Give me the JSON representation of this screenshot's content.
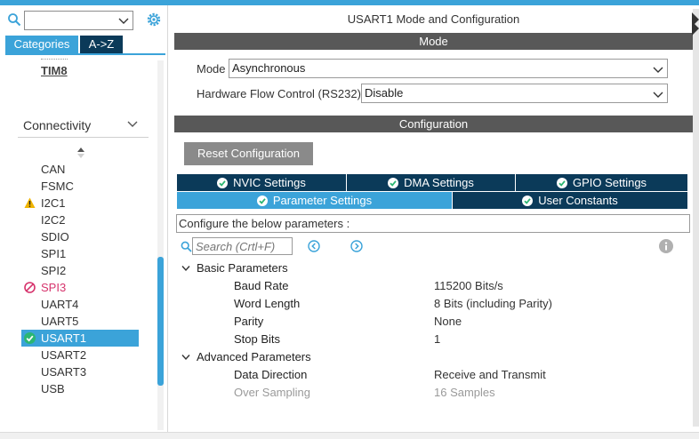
{
  "colors": {
    "accent": "#3ba3d9",
    "dark_tab": "#0b3a59",
    "bar": "#585858",
    "ok": "#2bb673",
    "warn": "#f0b400",
    "error": "#d6336c"
  },
  "left": {
    "search_value": "",
    "tabs": [
      {
        "label": "Categories",
        "active": true
      },
      {
        "label": "A->Z",
        "active": false
      }
    ],
    "timer_item": "TIM8",
    "category": "Connectivity",
    "peripherals": [
      {
        "label": "CAN",
        "status": "none"
      },
      {
        "label": "FSMC",
        "status": "none"
      },
      {
        "label": "I2C1",
        "status": "warning"
      },
      {
        "label": "I2C2",
        "status": "none"
      },
      {
        "label": "SDIO",
        "status": "none"
      },
      {
        "label": "SPI1",
        "status": "none"
      },
      {
        "label": "SPI2",
        "status": "none"
      },
      {
        "label": "SPI3",
        "status": "error"
      },
      {
        "label": "UART4",
        "status": "none"
      },
      {
        "label": "UART5",
        "status": "none"
      },
      {
        "label": "USART1",
        "status": "ok",
        "selected": true
      },
      {
        "label": "USART2",
        "status": "none"
      },
      {
        "label": "USART3",
        "status": "none"
      },
      {
        "label": "USB",
        "status": "none"
      }
    ]
  },
  "main": {
    "title": "USART1 Mode and Configuration",
    "mode_header": "Mode",
    "mode_label": "Mode",
    "mode_value": "Asynchronous",
    "flow_label": "Hardware Flow Control (RS232)",
    "flow_value": "Disable",
    "config_header": "Configuration",
    "reset_button": "Reset Configuration",
    "settings_tabs": [
      {
        "label": "NVIC Settings"
      },
      {
        "label": "DMA Settings"
      },
      {
        "label": "GPIO Settings"
      },
      {
        "label": "Parameter Settings",
        "active": true
      },
      {
        "label": "User Constants"
      }
    ],
    "configure_text": "Configure the below parameters :",
    "search_placeholder": "Search (Crtl+F)",
    "groups": [
      {
        "name": "Basic Parameters",
        "params": [
          {
            "name": "Baud Rate",
            "value": "115200 Bits/s"
          },
          {
            "name": "Word Length",
            "value": "8 Bits (including Parity)"
          },
          {
            "name": "Parity",
            "value": "None"
          },
          {
            "name": "Stop Bits",
            "value": "1"
          }
        ]
      },
      {
        "name": "Advanced Parameters",
        "params": [
          {
            "name": "Data Direction",
            "value": "Receive and Transmit"
          },
          {
            "name": "Over Sampling",
            "value": "16 Samples",
            "disabled": true
          }
        ]
      }
    ]
  }
}
